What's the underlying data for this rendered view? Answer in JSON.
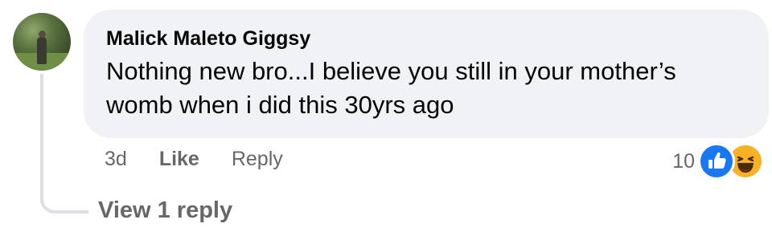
{
  "comment": {
    "author": "Malick Maleto Giggsy",
    "text": "Nothing new bro...I believe you still in your mother’s womb when i did this 30yrs ago",
    "line1": "Nothing new bro...I believe you still in your mother’s",
    "line2": "womb when i did this 30yrs ago"
  },
  "actions": {
    "time": "3d",
    "like_label": "Like",
    "reply_label": "Reply"
  },
  "reactions": {
    "count": "10",
    "icons": [
      "like-icon",
      "haha-icon"
    ],
    "like_color": "#1877f2",
    "haha_color": "#f7b125"
  },
  "replies": {
    "label": "View 1 reply"
  }
}
